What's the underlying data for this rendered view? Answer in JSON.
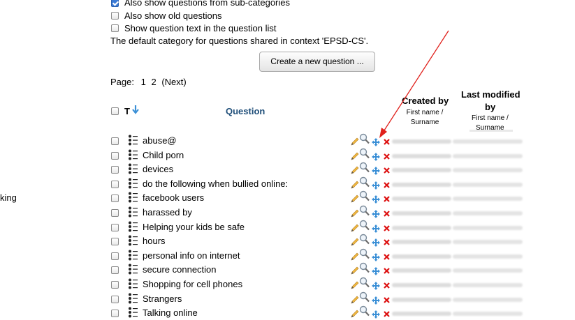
{
  "options": {
    "sub_categories": {
      "label": "Also show questions from sub-categories",
      "checked": true
    },
    "old_questions": {
      "label": "Also show old questions",
      "checked": false
    },
    "question_text": {
      "label": "Show question text in the question list",
      "checked": false
    }
  },
  "default_category_text": "The default category for questions shared in context 'EPSD-CS'.",
  "create_button_label": "Create a new question ...",
  "pagination": {
    "label": "Page:",
    "pages": [
      "1",
      "2"
    ],
    "next": "(Next)"
  },
  "side_text": "king",
  "table": {
    "type_header": "T",
    "question_header": "Question",
    "created_by_header": "Created by",
    "created_by_sub": "First name / Surname",
    "last_modified_header_line1": "Last modified",
    "last_modified_header_line2": "by",
    "last_modified_sub_line1": "First name /",
    "last_modified_sub_line2": "Surname",
    "rows": [
      {
        "name": "abuse@"
      },
      {
        "name": "Child porn"
      },
      {
        "name": "devices"
      },
      {
        "name": "do the following when bullied online:"
      },
      {
        "name": "facebook users"
      },
      {
        "name": "harassed by"
      },
      {
        "name": "Helping your kids be safe"
      },
      {
        "name": "hours"
      },
      {
        "name": "personal info on internet"
      },
      {
        "name": "secure connection"
      },
      {
        "name": "Shopping for cell phones"
      },
      {
        "name": "Strangers"
      },
      {
        "name": "Talking online"
      }
    ]
  },
  "colors": {
    "annotation_arrow": "#e0201b",
    "sort_arrow": "#3a8fd6",
    "delete_icon": "#d11"
  }
}
